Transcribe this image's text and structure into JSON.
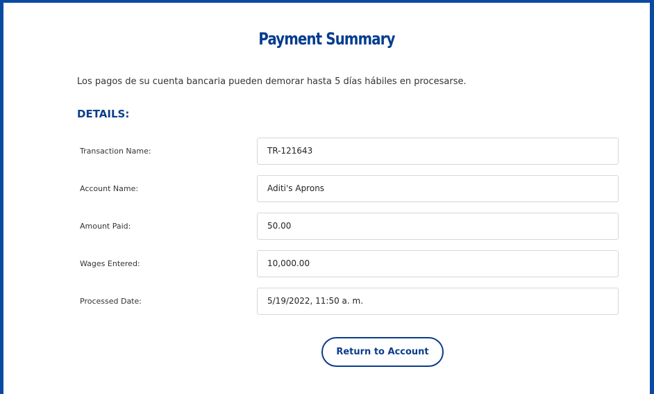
{
  "page": {
    "title": "Payment Summary",
    "notice": "Los pagos de su cuenta bancaria pueden demorar hasta 5 días hábiles en procesarse."
  },
  "details": {
    "heading": "DETAILS:",
    "rows": [
      {
        "label": "Transaction Name:",
        "value": "TR-121643"
      },
      {
        "label": "Account Name:",
        "value": "Aditi's Aprons"
      },
      {
        "label": "Amount Paid:",
        "value": "50.00"
      },
      {
        "label": "Wages Entered:",
        "value": "10,000.00"
      },
      {
        "label": "Processed Date:",
        "value": "5/19/2022, 11:50 a. m."
      }
    ]
  },
  "actions": {
    "return_label": "Return to Account"
  },
  "colors": {
    "brand_blue": "#0b4aa2",
    "heading_blue": "#003c8f"
  }
}
